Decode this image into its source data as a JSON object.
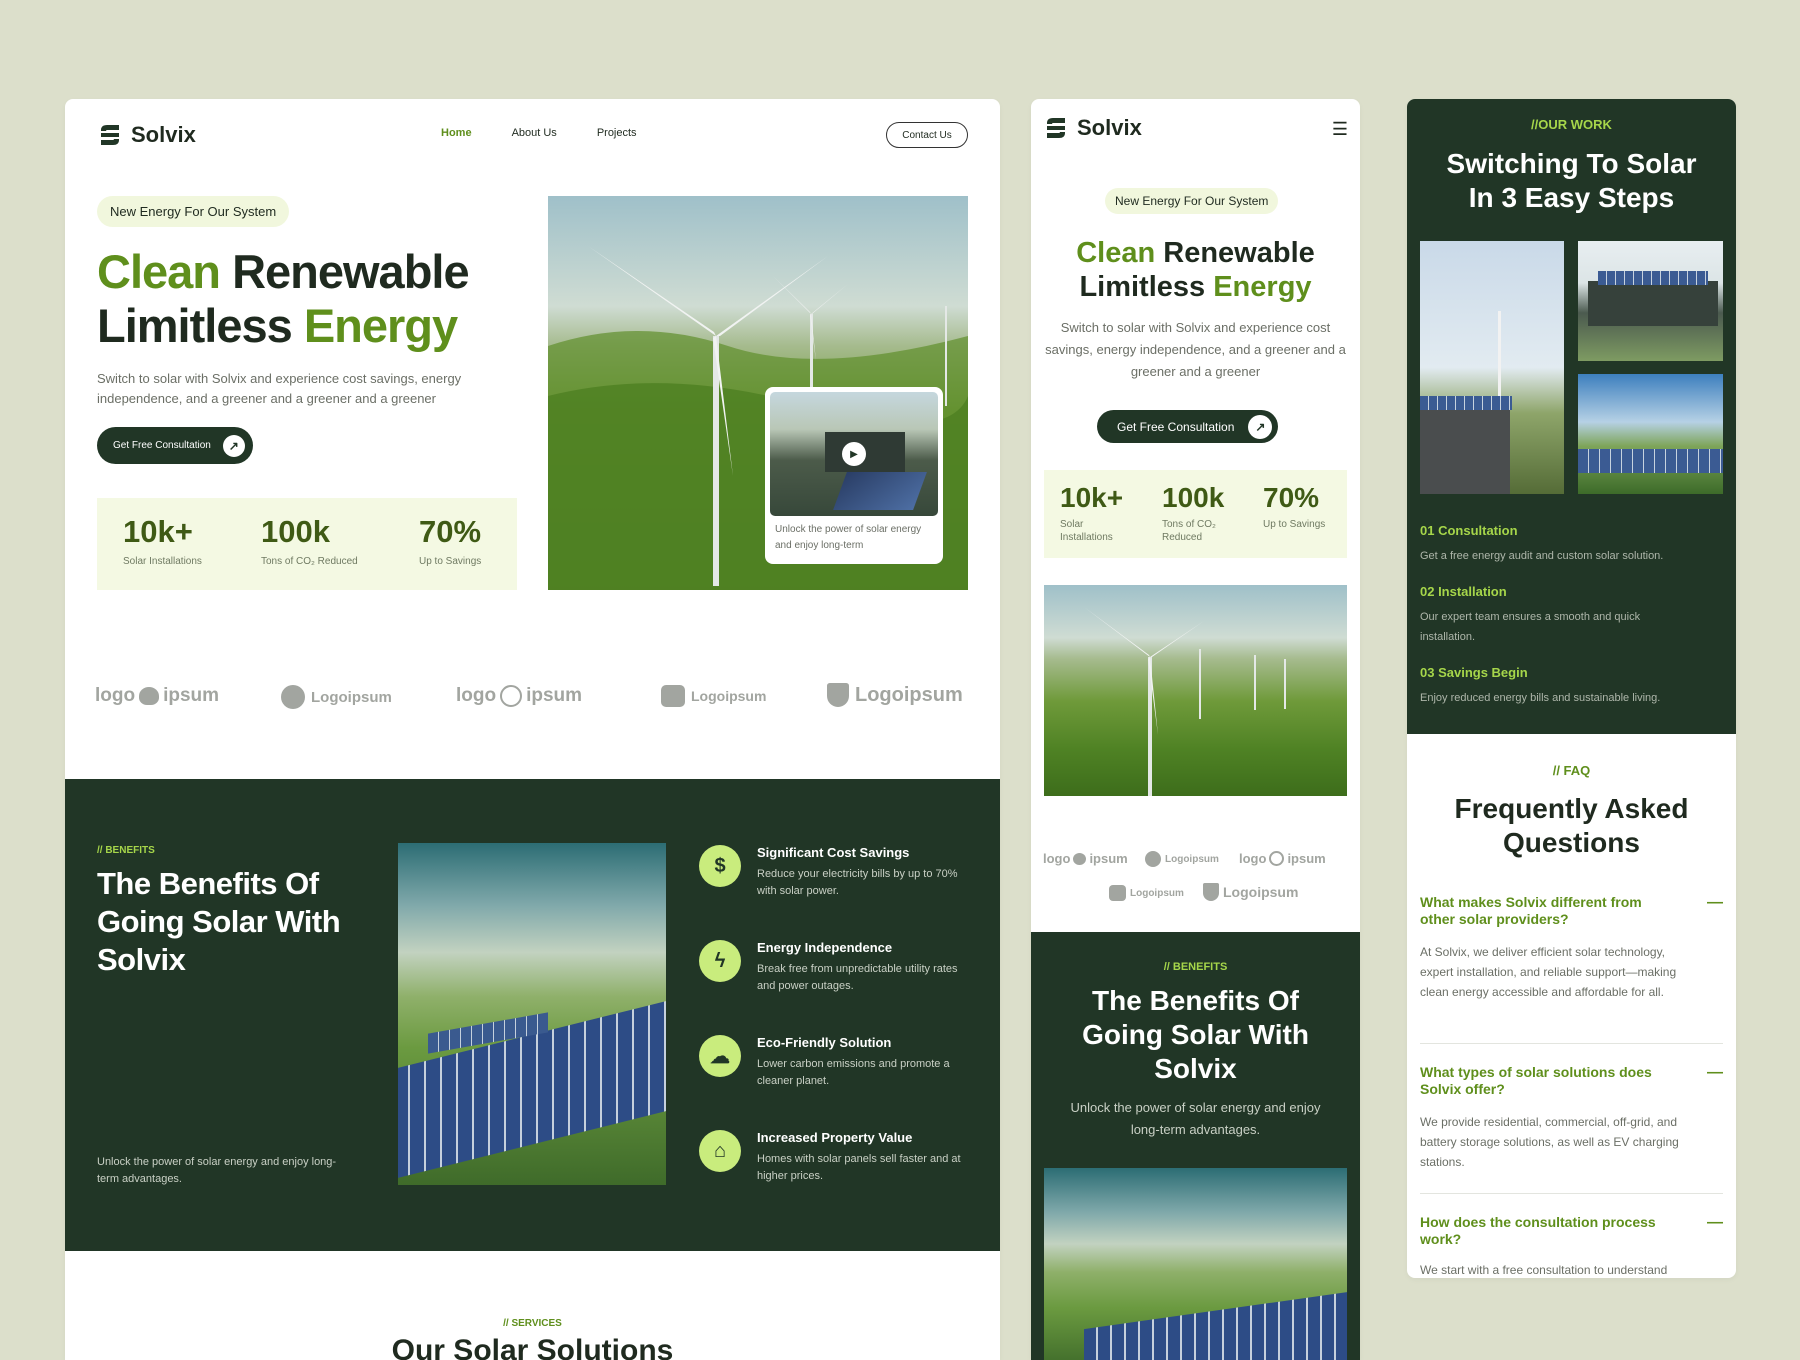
{
  "brand": {
    "name": "Solvix"
  },
  "nav": {
    "home": "Home",
    "about": "About Us",
    "projects": "Projects",
    "contact": "Contact Us"
  },
  "hero": {
    "tag": "New Energy For Our System",
    "title_w1": "Clean",
    "title_w2": "Renewable",
    "title_w3": "Limitless",
    "title_w4": "Energy",
    "desc": "Switch to solar with Solvix and experience cost savings, energy independence, and a greener and a greener and a greener",
    "mobile_desc": "Switch to solar with Solvix and experience cost savings, energy independence, and a greener and a greener and a greener",
    "cta": "Get Free Consultation",
    "video_caption": "Unlock the power of solar energy and enjoy long-term"
  },
  "stats": [
    {
      "value": "10k+",
      "label": "Solar Installations"
    },
    {
      "value": "100k",
      "label": "Tons of CO₂ Reduced"
    },
    {
      "value": "70%",
      "label": "Up to Savings"
    }
  ],
  "logos": [
    "logo",
    "ipsum",
    "Logoipsum",
    "logo",
    "ipsum",
    "Logoipsum",
    "Logoipsum"
  ],
  "benefits": {
    "tag": "// BENEFITS",
    "title": "The Benefits Of Going Solar With Solvix",
    "desc": "Unlock the power of solar energy and enjoy long-term advantages.",
    "items": [
      {
        "title": "Significant Cost Savings",
        "desc": "Reduce your electricity bills by up to 70% with solar power."
      },
      {
        "title": "Energy Independence",
        "desc": "Break free from unpredictable utility rates and power outages."
      },
      {
        "title": "Eco-Friendly Solution",
        "desc": "Lower carbon emissions and promote a cleaner planet."
      },
      {
        "title": "Increased Property Value",
        "desc": "Homes with solar panels sell faster and at higher prices."
      }
    ]
  },
  "services": {
    "tag": "// SERVICES",
    "title": "Our Solar Solutions"
  },
  "work": {
    "tag": "//OUR WORK",
    "title": "Switching To Solar In 3 Easy Steps",
    "steps": [
      {
        "title": "01 Consultation",
        "desc": "Get a free energy audit and custom solar solution."
      },
      {
        "title": "02 Installation",
        "desc": "Our expert team ensures a smooth and quick installation."
      },
      {
        "title": "03 Savings Begin",
        "desc": "Enjoy reduced energy bills and sustainable living."
      }
    ]
  },
  "faq": {
    "tag": "// FAQ",
    "title": "Frequently Asked Questions",
    "items": [
      {
        "q": "What makes Solvix different from other solar providers?",
        "a": "At Solvix, we deliver efficient solar technology, expert installation, and reliable support—making clean energy accessible and affordable for all."
      },
      {
        "q": "What types of solar solutions does Solvix offer?",
        "a": "We provide residential, commercial, off-grid, and battery storage solutions, as well as EV charging stations."
      },
      {
        "q": "How does the consultation process work?",
        "a": "We start with a free consultation to understand"
      }
    ]
  },
  "icons": {
    "dash": "—",
    "menu": "☰",
    "arrow": "↗",
    "play": "▶"
  }
}
